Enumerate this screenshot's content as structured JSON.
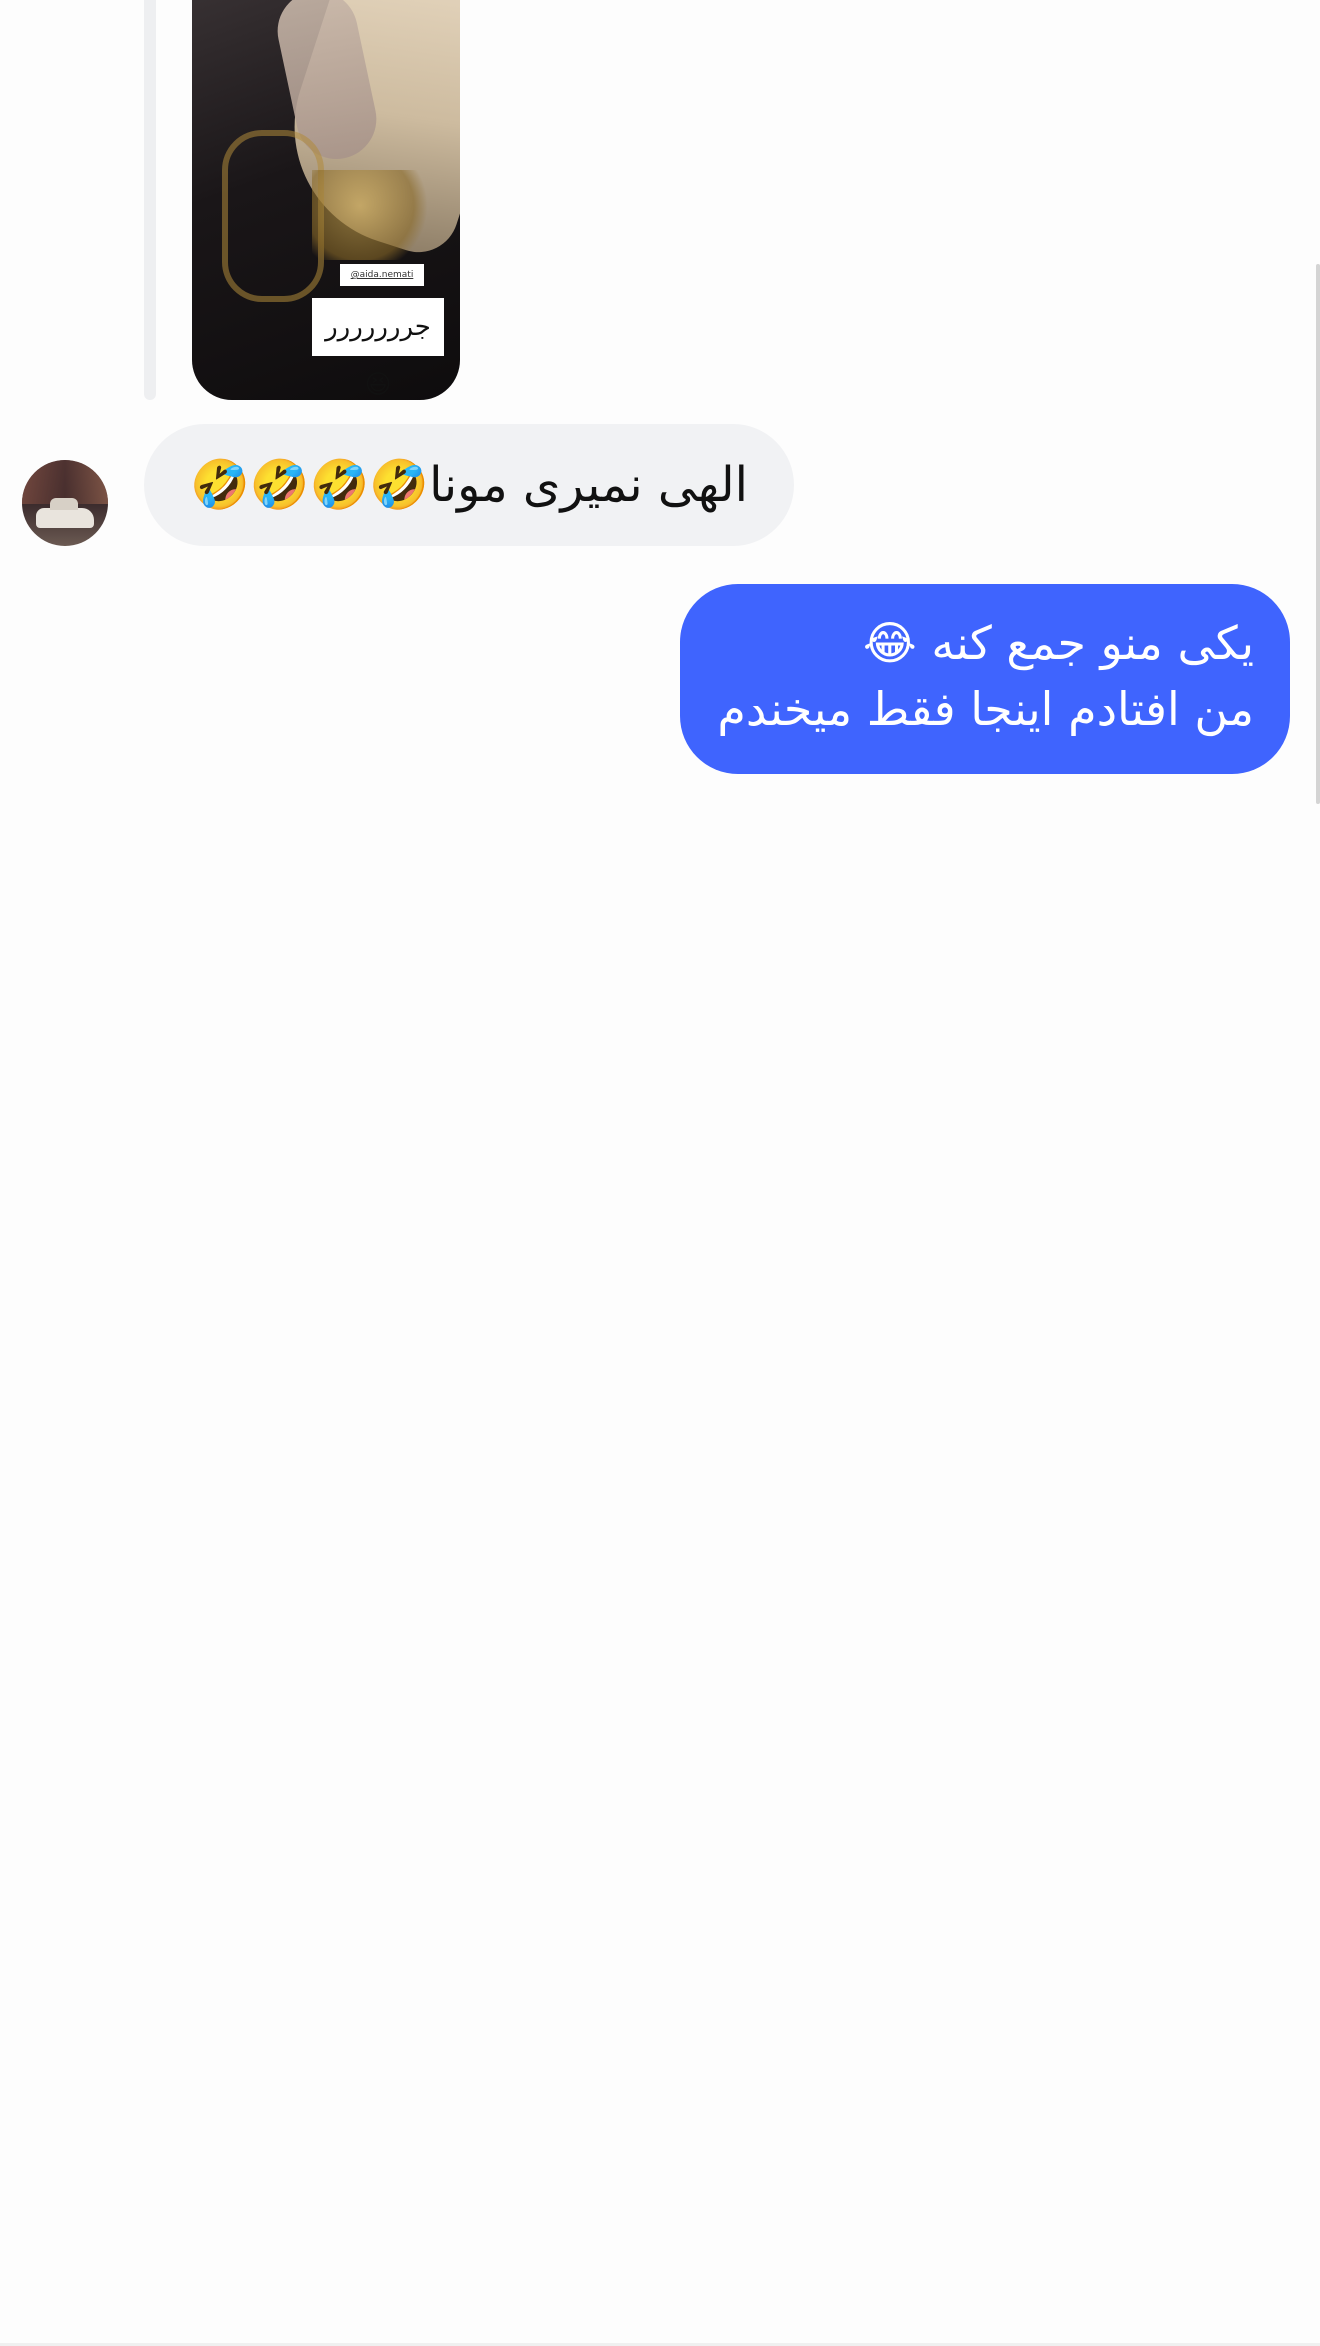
{
  "thread": {
    "story_reply": {
      "mention": "@aida.nemati",
      "caption": "جررررررر😆"
    },
    "incoming": {
      "text": "الهی نمیری مونا🤣🤣🤣🤣"
    },
    "outgoing": {
      "line1": "یکی منو جمع کنه 😂",
      "line2": "من افتادم اینجا فقط میخندم"
    }
  },
  "colors": {
    "outgoing_bubble": "#3f64fe",
    "incoming_bubble": "#f1f2f4",
    "background": "#fdfdfd"
  },
  "icons": {
    "avatar": "profile-photo-car"
  }
}
